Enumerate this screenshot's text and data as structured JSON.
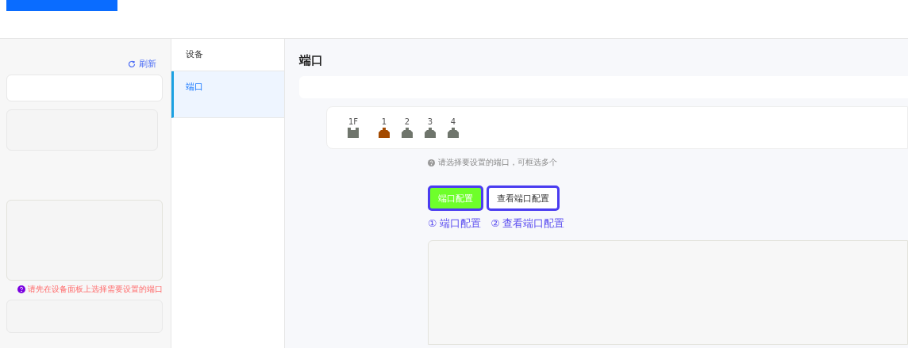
{
  "left_panel": {
    "refresh": "刷新",
    "hint": "请先在设备面板上选择需要设置的端口"
  },
  "sidebar": {
    "items": [
      {
        "label": "设备",
        "selected": false
      },
      {
        "label": "端口",
        "selected": true
      }
    ]
  },
  "main": {
    "title": "端口",
    "ports": [
      {
        "label": "1F",
        "kind": "fiber",
        "color": "#6f756c"
      },
      {
        "label": "1",
        "kind": "ethernet",
        "color": "#a34a00"
      },
      {
        "label": "2",
        "kind": "ethernet",
        "color": "#6f756c"
      },
      {
        "label": "3",
        "kind": "ethernet",
        "color": "#6f756c"
      },
      {
        "label": "4",
        "kind": "ethernet",
        "color": "#6f756c"
      }
    ],
    "port_hint": "请选择要设置的端口，可框选多个",
    "buttons": [
      {
        "label": "端口配置",
        "kind": "primary"
      },
      {
        "label": "查看端口配置",
        "kind": "default"
      }
    ],
    "annotations": [
      "① 端口配置",
      "② 查看端口配置"
    ]
  }
}
